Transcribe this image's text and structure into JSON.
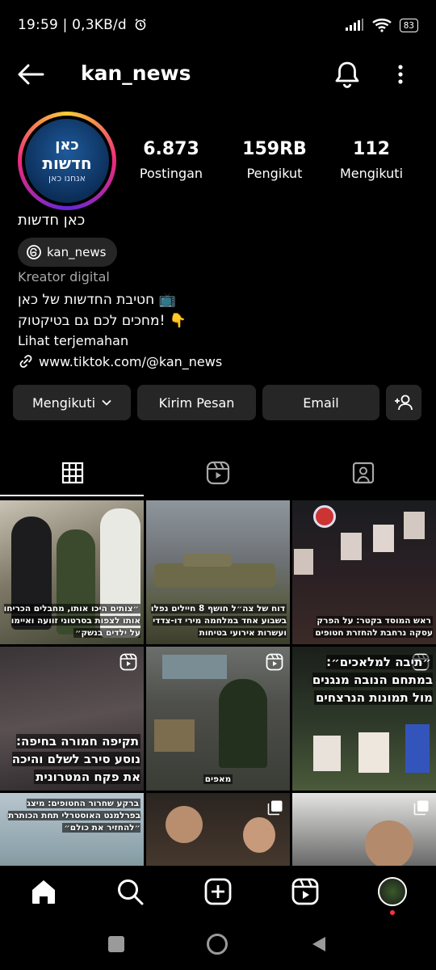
{
  "status": {
    "time": "19:59 | 0,3KB/d",
    "battery": "83"
  },
  "header": {
    "username": "kan_news"
  },
  "profile": {
    "avatar_line1": "כאן",
    "avatar_line2": "חדשות",
    "avatar_line3": "אנחנו כאן",
    "display_name": "כאן חדשות",
    "threads_handle": "kan_news",
    "category": "Kreator digital",
    "bio_line1": "חטיבת החדשות של כאן 📺",
    "bio_line2": "מחכים לכם גם בטיקטוק! 👇",
    "translate_label": "Lihat terjemahan",
    "link": "www.tiktok.com/@kan_news"
  },
  "stats": [
    {
      "value": "6.873",
      "label": "Postingan"
    },
    {
      "value": "159RB",
      "label": "Pengikut"
    },
    {
      "value": "112",
      "label": "Mengikuti"
    }
  ],
  "buttons": {
    "following": "Mengikuti",
    "message": "Kirim Pesan",
    "email": "Email"
  },
  "tabs": [
    "grid-icon",
    "reels-icon",
    "tagged-icon"
  ],
  "posts": [
    {
      "caption": "״צותים היכו אותו, מחבלים הכריחו אותו לצפות בסרטוני זוועה ואיימו על ילדים בנשק״",
      "type": "image"
    },
    {
      "caption": "דוח של צה״ל חושף 8 חיילים נפלו בשבוע אחד במלחמה מירי דו-צדדי ועשרות אירועי בטיחות",
      "type": "image"
    },
    {
      "caption": "ראש המוסד בקטר: על הפרק עסקה נרחבת להחזרת חטופים",
      "type": "image"
    },
    {
      "caption": "תקיפה חמורה בחיפה: נוסע סירב לשלם והיכה את פקח המטרונית",
      "type": "reel"
    },
    {
      "caption": "מאפים",
      "type": "reel"
    },
    {
      "caption": "״תיבה למלאכים״: במתחם הנובה מנגנים מול תמונות הנרצחים",
      "type": "reel"
    },
    {
      "caption": "ברקע שחרור החטופים: מיצג בפרלמנט האוסטרלי תחת הכותרת ״להחזיר את כולם״",
      "type": "image"
    },
    {
      "caption": "",
      "type": "multi"
    },
    {
      "caption": "",
      "type": "multi"
    }
  ],
  "colors": {
    "background": "#000000",
    "button": "#262626",
    "secondary_text": "#a8a8a8",
    "notification_dot": "#ff3040"
  }
}
